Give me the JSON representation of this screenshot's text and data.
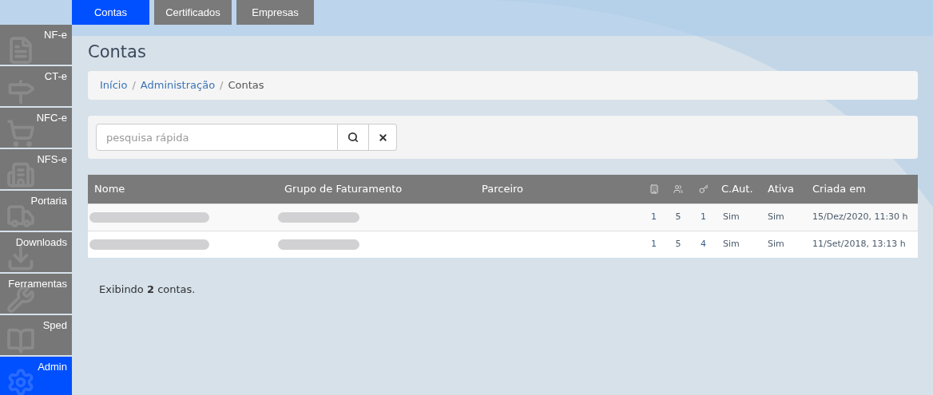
{
  "top_tabs": [
    {
      "label": "Contas",
      "selected": true
    },
    {
      "label": "Certificados",
      "selected": false
    },
    {
      "label": "Empresas",
      "selected": false
    }
  ],
  "sidebar": {
    "items": [
      {
        "label": "NF-e",
        "selected": false
      },
      {
        "label": "CT-e",
        "selected": false
      },
      {
        "label": "NFC-e",
        "selected": false
      },
      {
        "label": "NFS-e",
        "selected": false
      },
      {
        "label": "Portaria",
        "selected": false
      },
      {
        "label": "Downloads",
        "selected": false
      },
      {
        "label": "Ferramentas",
        "selected": false
      },
      {
        "label": "Sped",
        "selected": false
      },
      {
        "label": "Admin",
        "selected": true
      }
    ]
  },
  "page_title": "Contas",
  "breadcrumb": [
    {
      "label": "Início",
      "link": true
    },
    {
      "separator": "/",
      "label": "Administração",
      "link": true
    },
    {
      "separator": "/",
      "label": "Contas",
      "link": false
    }
  ],
  "search": {
    "placeholder": "pesquisa rápida"
  },
  "table": {
    "columns": [
      {
        "label": "Nome"
      },
      {
        "label": "Grupo de Faturamento"
      },
      {
        "label": "Parceiro"
      },
      {
        "kind": "building"
      },
      {
        "kind": "users"
      },
      {
        "kind": "key"
      },
      {
        "label": "C.Aut."
      },
      {
        "label": "Ativa"
      },
      {
        "label": "Criada em"
      }
    ],
    "rows": [
      {
        "companies": "1",
        "users": "5",
        "keys": "1",
        "auto": "Sim",
        "active": "Sim",
        "created": "15/Dez/2020, 11:30 h"
      },
      {
        "companies": "1",
        "users": "5",
        "keys": "4",
        "auto": "Sim",
        "active": "Sim",
        "created": "11/Set/2018, 13:13 h"
      }
    ]
  },
  "summary": "Exibindo **2** contas."
}
